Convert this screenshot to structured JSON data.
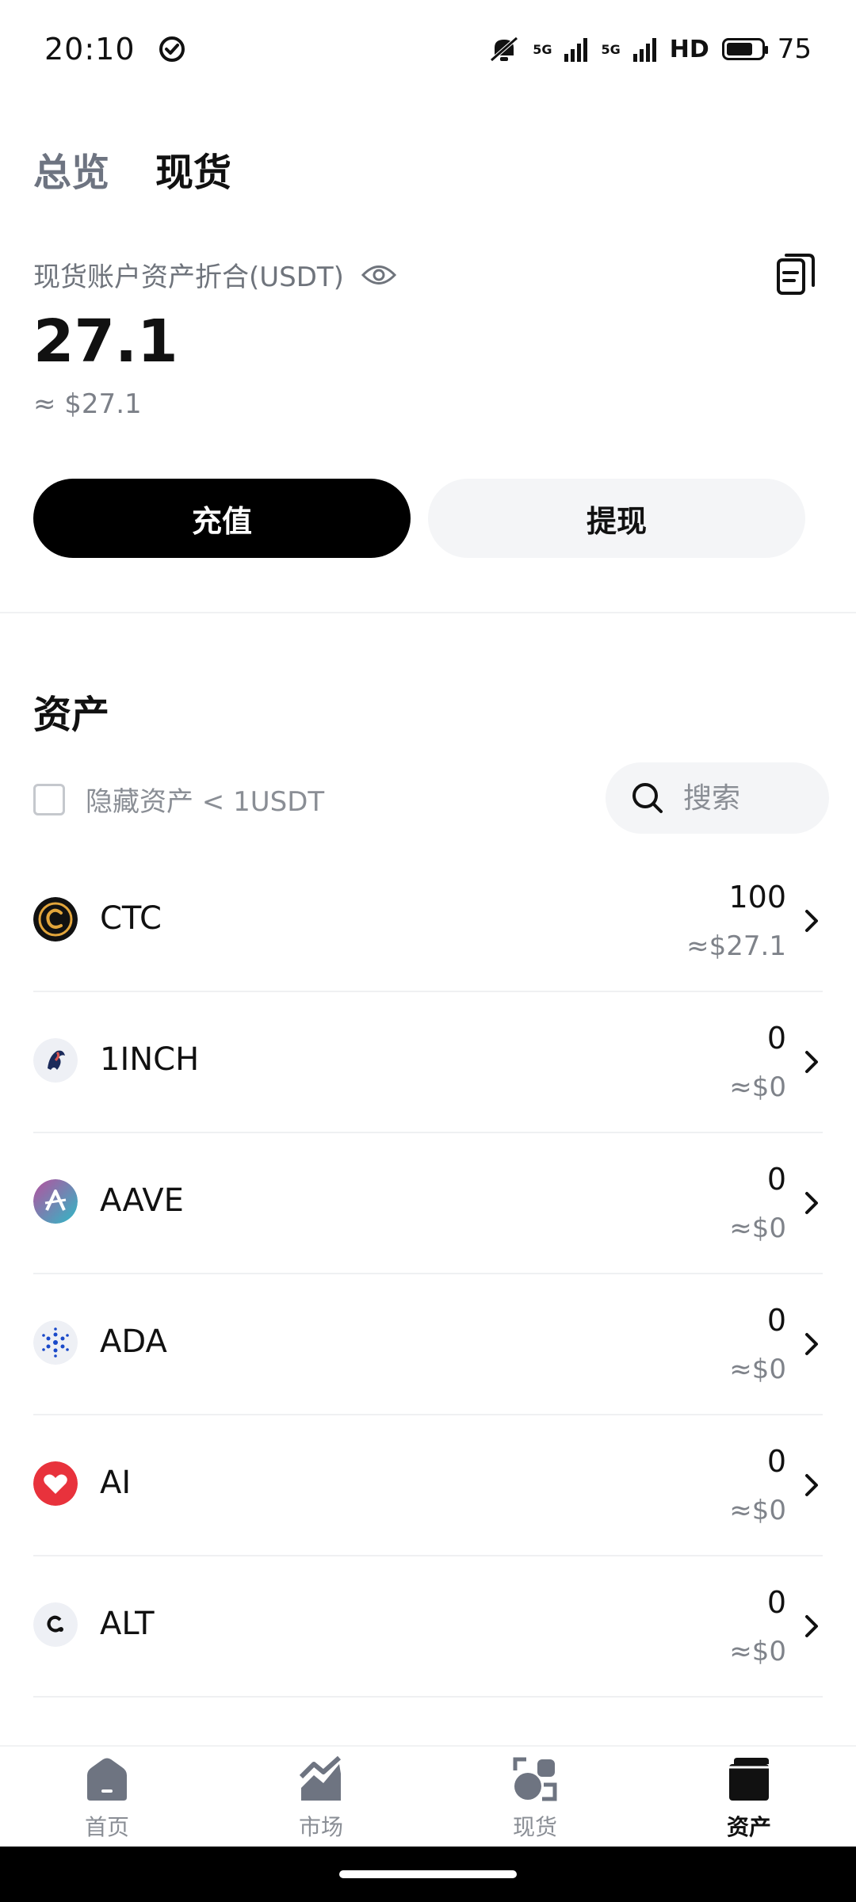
{
  "status_bar": {
    "time": "20:10",
    "network1": "5G",
    "network2": "5G",
    "hd": "HD",
    "battery": "75",
    "battery_level": 0.75
  },
  "tabs": [
    {
      "label": "总览",
      "active": false
    },
    {
      "label": "现货",
      "active": true
    }
  ],
  "balance": {
    "label": "现货账户资产折合(USDT)",
    "value": "27.1",
    "usd": "≈ $27.1"
  },
  "actions": {
    "deposit": "充值",
    "withdraw": "提现"
  },
  "assets": {
    "title": "资产",
    "hide_label": "隐藏资产 < 1USDT",
    "hide_checked": false,
    "search_placeholder": "搜索",
    "items": [
      {
        "name": "CTC",
        "amount": "100",
        "usd": "≈$27.1",
        "icon": "ctc-coin-icon"
      },
      {
        "name": "1INCH",
        "amount": "0",
        "usd": "≈$0",
        "icon": "1inch-coin-icon"
      },
      {
        "name": "AAVE",
        "amount": "0",
        "usd": "≈$0",
        "icon": "aave-coin-icon"
      },
      {
        "name": "ADA",
        "amount": "0",
        "usd": "≈$0",
        "icon": "ada-coin-icon"
      },
      {
        "name": "AI",
        "amount": "0",
        "usd": "≈$0",
        "icon": "ai-coin-icon"
      },
      {
        "name": "ALT",
        "amount": "0",
        "usd": "≈$0",
        "icon": "alt-coin-icon"
      }
    ]
  },
  "bottom_nav": [
    {
      "label": "首页",
      "icon": "home-icon",
      "active": false
    },
    {
      "label": "市场",
      "icon": "market-icon",
      "active": false
    },
    {
      "label": "现货",
      "icon": "spot-icon",
      "active": false
    },
    {
      "label": "资产",
      "icon": "assets-icon",
      "active": true
    }
  ],
  "colors": {
    "primary": "#000000",
    "muted": "#8a8e95",
    "surface": "#f4f5f7"
  }
}
